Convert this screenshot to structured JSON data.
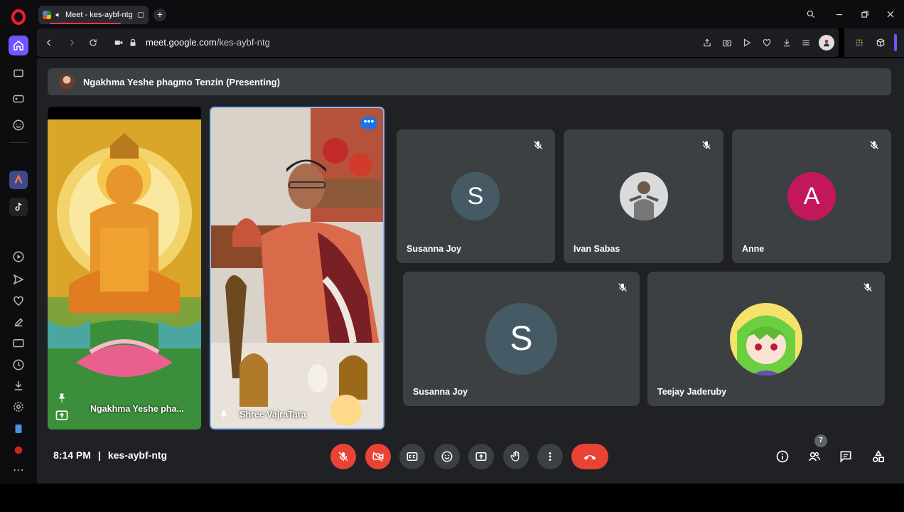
{
  "browser": {
    "tab_title": "Meet - kes-aybf-ntg",
    "url_domain": "meet.google.com",
    "url_path": "/kes-aybf-ntg",
    "new_tab_symbol": "+"
  },
  "presenting_banner": "Ngakhma Yeshe phagmo Tenzin (Presenting)",
  "tiles": [
    {
      "name": "Ngakhma Yeshe pha...",
      "kind": "video"
    },
    {
      "name": "Shree VajraTara",
      "kind": "video"
    },
    {
      "name": "Susanna Joy",
      "initial": "S",
      "avatar_color": "#455a64",
      "muted": true
    },
    {
      "name": "Ivan Sabas",
      "initial": "",
      "avatar_color": "#cfd8dc",
      "muted": true
    },
    {
      "name": "Anne",
      "initial": "A",
      "avatar_color": "#c2185b",
      "muted": true
    },
    {
      "name": "Susanna Joy",
      "initial": "S",
      "avatar_color": "#455a64",
      "muted": true
    },
    {
      "name": "Teejay Jaderuby",
      "initial": "",
      "avatar_color": "#8bc34a",
      "muted": true
    }
  ],
  "footer": {
    "time": "8:14 PM",
    "separator": "|",
    "meeting_code": "kes-aybf-ntg",
    "participant_count": "7"
  },
  "colors": {
    "accent_red": "#ea4335",
    "meet_bg": "#202124",
    "tile_bg": "#3c4043",
    "opera_accent": "#6f57ff"
  }
}
